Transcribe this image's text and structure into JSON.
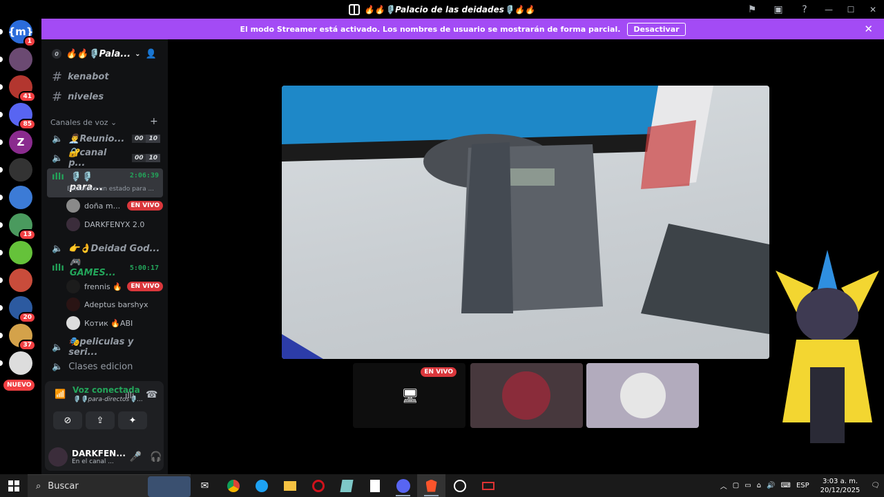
{
  "window": {
    "title": "🔥🔥🎙️Palacio de las deidades🎙️🔥🔥"
  },
  "banner": {
    "message": "El modo Streamer está activado. Los nombres de usuario se mostrarán de forma parcial.",
    "button": "Desactivar"
  },
  "servers": [
    {
      "label": "{m}",
      "badge": "1",
      "color": "#2b6cdb"
    },
    {
      "label": "",
      "badge": "",
      "color": "#6b4a72"
    },
    {
      "label": "",
      "badge": "41",
      "color": "#b3362f"
    },
    {
      "label": "",
      "badge": "85",
      "color": "#5865f2"
    },
    {
      "label": "Z",
      "badge": "",
      "color": "#8a2b8e"
    },
    {
      "label": "",
      "badge": "",
      "color": "#333"
    },
    {
      "label": "",
      "badge": "",
      "color": "#3c7bd6"
    },
    {
      "label": "",
      "badge": "13",
      "color": "#4a9a5e"
    },
    {
      "label": "",
      "badge": "",
      "color": "#65c23a"
    },
    {
      "label": "",
      "badge": "",
      "color": "#c94c3b"
    },
    {
      "label": "",
      "badge": "20",
      "color": "#2c5aa0"
    },
    {
      "label": "",
      "badge": "37",
      "color": "#d4a24a"
    },
    {
      "label": "",
      "badge": "",
      "color": "#ddd"
    }
  ],
  "servers_new_label": "NUEVO",
  "guild": {
    "boost": "0",
    "name": "🔥🔥🎙️Pala..."
  },
  "channels": {
    "text": [
      "kenabot",
      "niveles"
    ],
    "voice_category": "Canales de voz",
    "voice": [
      {
        "name": "👨‍💼Reunio...",
        "a": "00",
        "b": "10"
      },
      {
        "name": "🔐canal p...",
        "a": "00",
        "b": "10"
      },
      {
        "name": "🎙️🎙️para...",
        "timer": "2:06:39",
        "status": "Establece un estado para ..."
      },
      {
        "name": "👉👌Deidad God..."
      },
      {
        "name": "🎮GAMES...",
        "timer": "5:00:17"
      },
      {
        "name": "🎭peliculas y seri..."
      },
      {
        "name": "Clases edicion"
      }
    ],
    "members_para": [
      {
        "name": "doña m...",
        "live": "EN VIVO"
      },
      {
        "name": "DARKFENYX 2.0",
        "live": ""
      }
    ],
    "members_games": [
      {
        "name": "frennis 🔥",
        "live": "EN VIVO"
      },
      {
        "name": "Adeptus barshyx",
        "live": ""
      },
      {
        "name": "Котик 🔥ABI",
        "live": ""
      }
    ]
  },
  "voice_panel": {
    "title": "Voz conectada",
    "channel": "🎙️🎙️para-directos🎙️..."
  },
  "user_panel": {
    "name": "DARKFEN...",
    "status": "En el canal ..."
  },
  "stage": {
    "live_label": "EN VIVO"
  },
  "taskbar": {
    "search_placeholder": "Buscar",
    "lang": "ESP",
    "time": "3:03 a. m.",
    "date": "20/12/2025"
  },
  "colors": {
    "accent": "#a34bf5",
    "live": "#da373c",
    "connected": "#23a55a",
    "badge": "#f23f42"
  }
}
